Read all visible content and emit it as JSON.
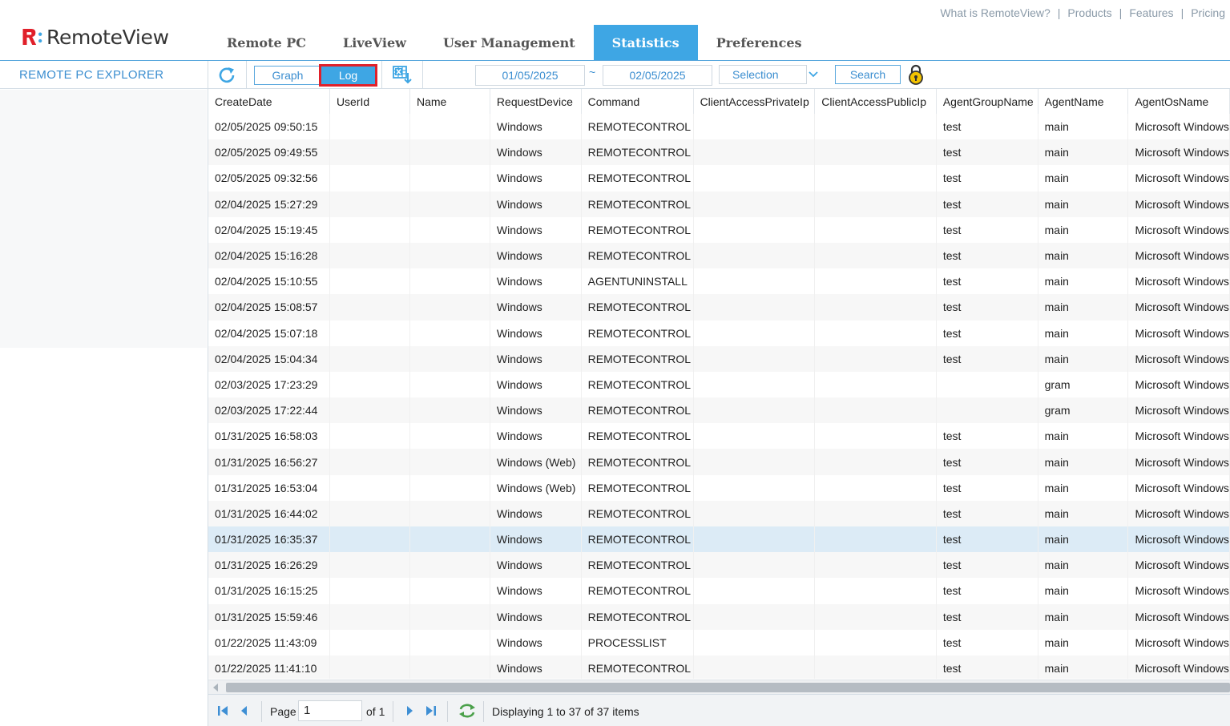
{
  "app": {
    "logo_text": "RemoteView",
    "top_links": [
      "What is RemoteView?",
      "Products",
      "Features",
      "Pricing"
    ],
    "nav_tabs": [
      {
        "label": "Remote PC",
        "active": false
      },
      {
        "label": "LiveView",
        "active": false
      },
      {
        "label": "User Management",
        "active": false
      },
      {
        "label": "Statistics",
        "active": true
      },
      {
        "label": "Preferences",
        "active": false
      }
    ]
  },
  "sidebar": {
    "title": "REMOTE PC EXPLORER"
  },
  "toolbar": {
    "graph_label": "Graph",
    "log_label": "Log",
    "date_from": "01/05/2025",
    "date_sep": "~",
    "date_to": "02/05/2025",
    "selection_label": "Selection",
    "search_label": "Search"
  },
  "grid": {
    "columns": [
      "CreateDate",
      "UserId",
      "Name",
      "RequestDevice",
      "Command",
      "ClientAccessPrivateIp",
      "ClientAccessPublicIp",
      "AgentGroupName",
      "AgentName",
      "AgentOsName"
    ],
    "rows": [
      [
        "02/05/2025 09:50:15",
        "",
        "",
        "Windows",
        "REMOTECONTROL",
        "",
        "",
        "test",
        "main",
        "Microsoft Windows"
      ],
      [
        "02/05/2025 09:49:55",
        "",
        "",
        "Windows",
        "REMOTECONTROL",
        "",
        "",
        "test",
        "main",
        "Microsoft Windows"
      ],
      [
        "02/05/2025 09:32:56",
        "",
        "",
        "Windows",
        "REMOTECONTROL",
        "",
        "",
        "test",
        "main",
        "Microsoft Windows"
      ],
      [
        "02/04/2025 15:27:29",
        "",
        "",
        "Windows",
        "REMOTECONTROL",
        "",
        "",
        "test",
        "main",
        "Microsoft Windows"
      ],
      [
        "02/04/2025 15:19:45",
        "",
        "",
        "Windows",
        "REMOTECONTROL",
        "",
        "",
        "test",
        "main",
        "Microsoft Windows"
      ],
      [
        "02/04/2025 15:16:28",
        "",
        "",
        "Windows",
        "REMOTECONTROL",
        "",
        "",
        "test",
        "main",
        "Microsoft Windows"
      ],
      [
        "02/04/2025 15:10:55",
        "",
        "",
        "Windows",
        "AGENTUNINSTALL",
        "",
        "",
        "test",
        "main",
        "Microsoft Windows"
      ],
      [
        "02/04/2025 15:08:57",
        "",
        "",
        "Windows",
        "REMOTECONTROL",
        "",
        "",
        "test",
        "main",
        "Microsoft Windows"
      ],
      [
        "02/04/2025 15:07:18",
        "",
        "",
        "Windows",
        "REMOTECONTROL",
        "",
        "",
        "test",
        "main",
        "Microsoft Windows"
      ],
      [
        "02/04/2025 15:04:34",
        "",
        "",
        "Windows",
        "REMOTECONTROL",
        "",
        "",
        "test",
        "main",
        "Microsoft Windows"
      ],
      [
        "02/03/2025 17:23:29",
        "",
        "",
        "Windows",
        "REMOTECONTROL",
        "",
        "",
        "",
        "gram",
        "Microsoft Windows"
      ],
      [
        "02/03/2025 17:22:44",
        "",
        "",
        "Windows",
        "REMOTECONTROL",
        "",
        "",
        "",
        "gram",
        "Microsoft Windows"
      ],
      [
        "01/31/2025 16:58:03",
        "",
        "",
        "Windows",
        "REMOTECONTROL",
        "",
        "",
        "test",
        "main",
        "Microsoft Windows"
      ],
      [
        "01/31/2025 16:56:27",
        "",
        "",
        "Windows (Web)",
        "REMOTECONTROL",
        "",
        "",
        "test",
        "main",
        "Microsoft Windows"
      ],
      [
        "01/31/2025 16:53:04",
        "",
        "",
        "Windows (Web)",
        "REMOTECONTROL",
        "",
        "",
        "test",
        "main",
        "Microsoft Windows"
      ],
      [
        "01/31/2025 16:44:02",
        "",
        "",
        "Windows",
        "REMOTECONTROL",
        "",
        "",
        "test",
        "main",
        "Microsoft Windows"
      ],
      [
        "01/31/2025 16:35:37",
        "",
        "",
        "Windows",
        "REMOTECONTROL",
        "",
        "",
        "test",
        "main",
        "Microsoft Windows"
      ],
      [
        "01/31/2025 16:26:29",
        "",
        "",
        "Windows",
        "REMOTECONTROL",
        "",
        "",
        "test",
        "main",
        "Microsoft Windows"
      ],
      [
        "01/31/2025 16:15:25",
        "",
        "",
        "Windows",
        "REMOTECONTROL",
        "",
        "",
        "test",
        "main",
        "Microsoft Windows"
      ],
      [
        "01/31/2025 15:59:46",
        "",
        "",
        "Windows",
        "REMOTECONTROL",
        "",
        "",
        "test",
        "main",
        "Microsoft Windows"
      ],
      [
        "01/22/2025 11:43:09",
        "",
        "",
        "Windows",
        "PROCESSLIST",
        "",
        "",
        "test",
        "main",
        "Microsoft Windows"
      ],
      [
        "01/22/2025 11:41:10",
        "",
        "",
        "Windows",
        "REMOTECONTROL",
        "",
        "",
        "test",
        "main",
        "Microsoft Windows"
      ]
    ],
    "selected_row": 16
  },
  "pager": {
    "page_label": "Page",
    "page_value": "1",
    "of_label": "of 1",
    "display_text": "Displaying 1 to 37 of 37 items"
  },
  "colors": {
    "accent": "#3ea6e4",
    "brand_red": "#e0202a",
    "lock_yellow": "#f2c200"
  },
  "icons": [
    "refresh-icon",
    "excel-export-icon",
    "lock-icon",
    "chevron-down-icon",
    "first-page-icon",
    "prev-page-icon",
    "next-page-icon",
    "last-page-icon",
    "reload-icon"
  ]
}
